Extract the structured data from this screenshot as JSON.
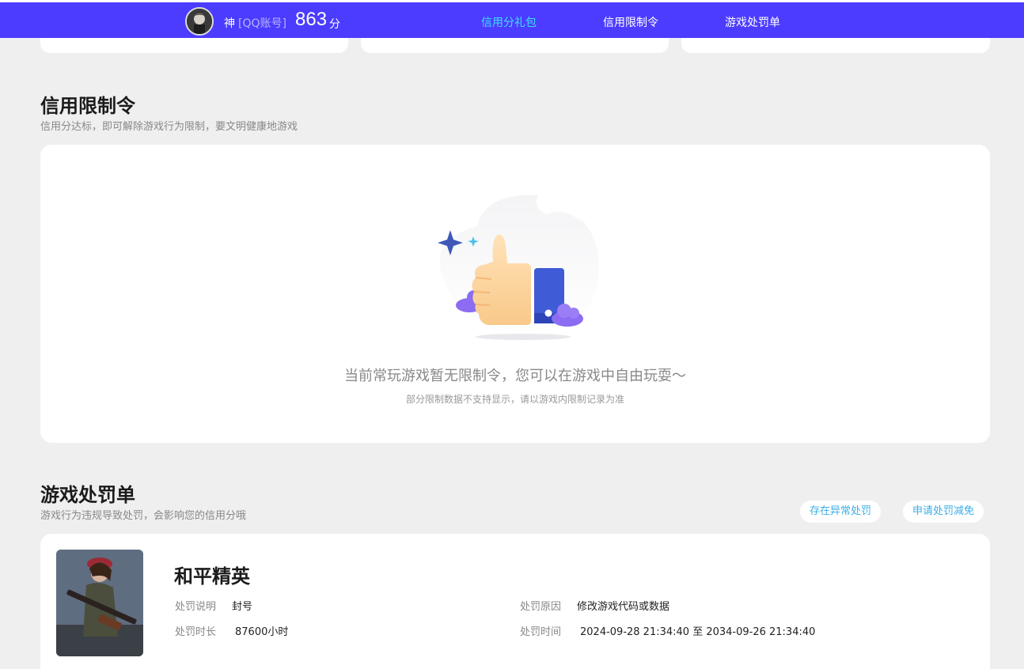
{
  "header": {
    "user_name": "神",
    "user_tag": "[QQ账号]",
    "score": "863",
    "score_unit": "分",
    "tabs": [
      {
        "label": "信用分礼包",
        "active": true
      },
      {
        "label": "信用限制令",
        "active": false
      },
      {
        "label": "游戏处罚单",
        "active": false
      }
    ],
    "accent_color": "#4b3cff",
    "active_color": "#3fe0ff"
  },
  "restriction": {
    "title": "信用限制令",
    "subtitle": "信用分达标，即可解除游戏行为限制，要文明健康地游戏",
    "empty_message": "当前常玩游戏暂无限制令，您可以在游戏中自由玩耍～",
    "empty_note": "部分限制数据不支持显示，请以游戏内限制记录为准",
    "illustration_icon": "thumbs-up-icon"
  },
  "penalty": {
    "title": "游戏处罚单",
    "subtitle": "游戏行为违规导致处罚，会影响您的信用分哦",
    "actions": {
      "abnormal": "存在异常处罚",
      "appeal": "申请处罚减免"
    },
    "record": {
      "game": "和平精英",
      "desc_label": "处罚说明",
      "desc_value": "封号",
      "duration_label": "处罚时长",
      "duration_value": "87600小时",
      "reason_label": "处罚原因",
      "reason_value": "修改游戏代码或数据",
      "time_label": "处罚时间",
      "time_value": "2024-09-28 21:34:40 至 2034-09-26 21:34:40"
    }
  }
}
